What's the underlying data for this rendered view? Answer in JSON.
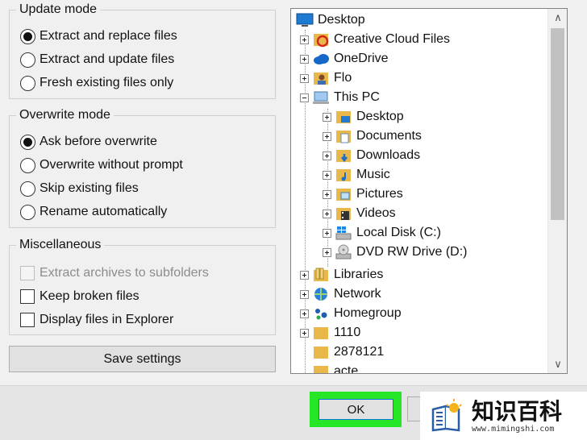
{
  "update_mode": {
    "legend": "Update mode",
    "options": [
      {
        "label": "Extract and replace files",
        "selected": true
      },
      {
        "label": "Extract and update files",
        "selected": false
      },
      {
        "label": "Fresh existing files only",
        "selected": false
      }
    ]
  },
  "overwrite_mode": {
    "legend": "Overwrite mode",
    "options": [
      {
        "label": "Ask before overwrite",
        "selected": true
      },
      {
        "label": "Overwrite without prompt",
        "selected": false
      },
      {
        "label": "Skip existing files",
        "selected": false
      },
      {
        "label": "Rename automatically",
        "selected": false
      }
    ]
  },
  "miscellaneous": {
    "legend": "Miscellaneous",
    "options": [
      {
        "label": "Extract archives to subfolders",
        "checked": false,
        "disabled": true
      },
      {
        "label": "Keep broken files",
        "checked": false,
        "disabled": false
      },
      {
        "label": "Display files in Explorer",
        "checked": false,
        "disabled": false
      }
    ]
  },
  "save_settings_label": "Save settings",
  "tree": {
    "items": [
      {
        "label": "Desktop",
        "icon": "desktop-icon"
      },
      {
        "label": "Creative Cloud Files",
        "icon": "creative-cloud-icon"
      },
      {
        "label": "OneDrive",
        "icon": "onedrive-icon"
      },
      {
        "label": "Flo",
        "icon": "user-folder-icon"
      },
      {
        "label": "This PC",
        "icon": "this-pc-icon"
      },
      {
        "label": "Desktop",
        "icon": "desktop-folder-icon"
      },
      {
        "label": "Documents",
        "icon": "documents-folder-icon"
      },
      {
        "label": "Downloads",
        "icon": "downloads-folder-icon"
      },
      {
        "label": "Music",
        "icon": "music-folder-icon"
      },
      {
        "label": "Pictures",
        "icon": "pictures-folder-icon"
      },
      {
        "label": "Videos",
        "icon": "videos-folder-icon"
      },
      {
        "label": "Local Disk (C:)",
        "icon": "local-disk-icon"
      },
      {
        "label": "DVD RW Drive (D:)",
        "icon": "dvd-drive-icon"
      },
      {
        "label": "Libraries",
        "icon": "libraries-icon"
      },
      {
        "label": "Network",
        "icon": "network-icon"
      },
      {
        "label": "Homegroup",
        "icon": "homegroup-icon"
      },
      {
        "label": "1110",
        "icon": "folder-icon"
      },
      {
        "label": "2878121",
        "icon": "folder-icon"
      },
      {
        "label": "acte",
        "icon": "folder-icon"
      }
    ]
  },
  "ok_label": "OK",
  "watermark": {
    "brand": "知识百科",
    "url": "www.mimingshi.com"
  },
  "colors": {
    "highlight": "#27e627",
    "folder": "#e8b94a",
    "accent": "#0078d7"
  }
}
